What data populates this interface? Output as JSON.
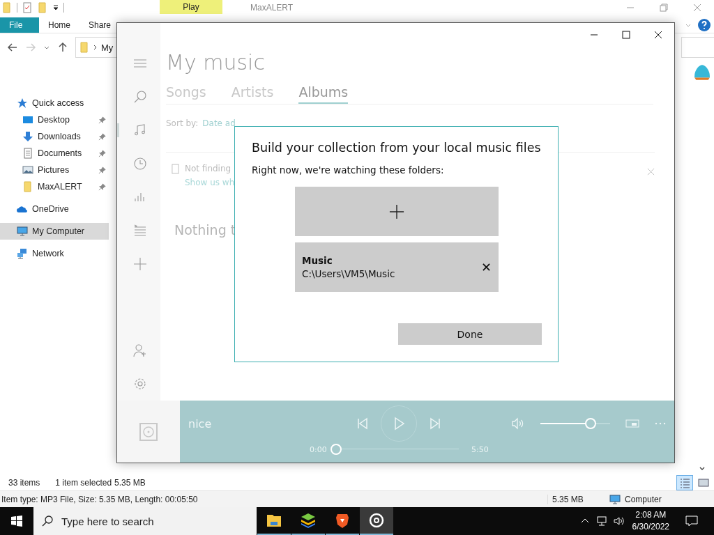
{
  "explorer": {
    "context_tab": "Play",
    "title": "MaxALERT",
    "ribbon_tabs": [
      {
        "label": "File",
        "selected": true
      },
      {
        "label": "Home",
        "selected": false
      },
      {
        "label": "Share",
        "selected": false
      }
    ],
    "address": {
      "path": "My"
    },
    "nav": [
      {
        "label": "Quick access",
        "kind": "star",
        "selected": false,
        "children": [
          {
            "label": "Desktop",
            "kind": "desktop",
            "pinned": true,
            "selected": false
          },
          {
            "label": "Downloads",
            "kind": "downloads",
            "pinned": true,
            "selected": false
          },
          {
            "label": "Documents",
            "kind": "documents",
            "pinned": true,
            "selected": false
          },
          {
            "label": "Pictures",
            "kind": "pictures",
            "pinned": true,
            "selected": false
          },
          {
            "label": "MaxALERT",
            "kind": "folder",
            "pinned": true,
            "selected": false
          }
        ]
      },
      {
        "label": "OneDrive",
        "kind": "cloud",
        "selected": false
      },
      {
        "label": "My Computer",
        "kind": "computer",
        "selected": true
      },
      {
        "label": "Network",
        "kind": "network",
        "selected": false
      }
    ],
    "status": {
      "count": "33 items",
      "selection": "1 item selected",
      "size": "5.35 MB"
    },
    "details": {
      "info": "Item type: MP3 File, Size: 5.35 MB, Length: 00:05:50",
      "size": "5.35 MB",
      "location": "Computer"
    },
    "views": [
      {
        "kind": "details",
        "selected": true
      },
      {
        "kind": "tiles",
        "selected": false
      }
    ]
  },
  "music": {
    "title": "My music",
    "sidebar_top": [
      {
        "kind": "menu",
        "selected": false
      },
      {
        "kind": "search",
        "selected": false
      },
      {
        "kind": "music",
        "selected": true
      },
      {
        "kind": "recent",
        "selected": false
      },
      {
        "kind": "charts",
        "selected": false
      },
      {
        "kind": "playlists",
        "selected": false
      },
      {
        "kind": "add",
        "selected": false
      }
    ],
    "sidebar_bottom": [
      {
        "kind": "account",
        "selected": false
      },
      {
        "kind": "settings",
        "selected": false
      }
    ],
    "tabs": [
      {
        "label": "Songs",
        "selected": false
      },
      {
        "label": "Artists",
        "selected": false
      },
      {
        "label": "Albums",
        "selected": true
      }
    ],
    "sort_label": "Sort by:",
    "sort_value": "Date ad",
    "notice": "Not finding",
    "notice_link": "Show us wh",
    "empty_message": "Nothing t",
    "player": {
      "track": "nice",
      "elapsed": "0:00",
      "duration": "5:50",
      "progress": {
        "level": 0
      },
      "volume": {
        "level": 0.72
      }
    },
    "dialog": {
      "title": "Build your collection from your local music files",
      "message": "Right now, we're watching these folders:",
      "folders": [
        {
          "name": "Music",
          "path": "C:\\Users\\VM5\\Music"
        }
      ],
      "done_button": "Done"
    }
  },
  "taskbar": {
    "search": {
      "placeholder": "Type here to search"
    },
    "apps": [
      {
        "kind": "explorer",
        "active": false
      },
      {
        "kind": "stack",
        "active": false
      },
      {
        "kind": "lion",
        "active": false
      },
      {
        "kind": "groove",
        "active": true
      }
    ],
    "time": "2:08 AM",
    "date": "6/30/2022"
  }
}
